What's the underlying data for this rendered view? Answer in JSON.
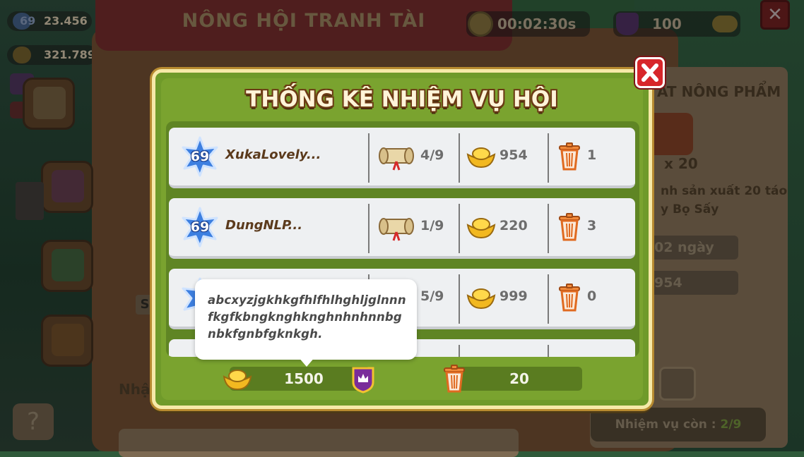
{
  "background": {
    "title": "NÔNG HỘI TRANH TÀI",
    "level": "69",
    "exp": "23.456",
    "coins": "321.789",
    "timer": "00:02:30s",
    "crown_count": "100",
    "right_panel": {
      "title": "AT NÔNG PHẨM",
      "multiplier": "x 20",
      "desc_line1": "nh sản xuất 20 táo",
      "desc_line2": "y Bọ Sấy",
      "days": "02 ngày",
      "gold": "954",
      "missions_label": "Nhiệm vụ còn :",
      "missions_value": "2/9"
    },
    "left_label": "Nhậ",
    "list_stub": "S",
    "help": "?",
    "close": "✕"
  },
  "modal": {
    "title": "THỐNG KÊ NHIỆM VỤ HỘI",
    "rows": [
      {
        "level": "69",
        "name": "XukaLovely...",
        "progress": "4/9",
        "gold": "954",
        "trash": "1"
      },
      {
        "level": "69",
        "name": "DungNLP...",
        "progress": "1/9",
        "gold": "220",
        "trash": "3"
      },
      {
        "level": "69",
        "name": "",
        "progress": "5/9",
        "gold": "999",
        "trash": "0"
      }
    ],
    "footer": {
      "gold_total": "1500",
      "trash_total": "20"
    }
  },
  "tooltip": {
    "text": "abcxyzjgkhkgfhlfhlhghljglnnnfkgfkbngknghknghnhnhnnbgnbkfgnbfgknkgh."
  },
  "colors": {
    "panel_green": "#7aa32f",
    "row_bg": "#eef0f2",
    "title_fill": "#fff4d8",
    "title_outline": "#6b3a14",
    "close_red": "#d7262a",
    "level_blue": "#3d7fe0"
  }
}
